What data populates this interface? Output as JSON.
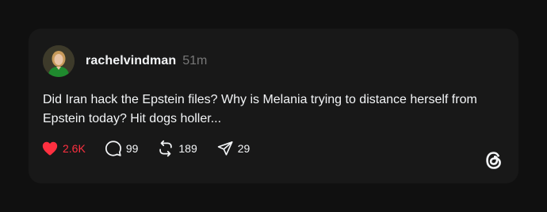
{
  "post": {
    "username": "rachelvindman",
    "timestamp": "51m",
    "text_line1": "Did Iran hack the Epstein files? Why is Melania trying to distance herself from",
    "text_line2": "Epstein today? Hit dogs holler..."
  },
  "actions": {
    "like_count": "2.6K",
    "comment_count": "99",
    "repost_count": "189",
    "share_count": "29"
  },
  "colors": {
    "background": "#101010",
    "card": "#181818",
    "text": "#f3f5f7",
    "muted": "#777777",
    "like": "#ff3040"
  },
  "icons": {
    "like": "heart-filled-icon",
    "comment": "comment-bubble-icon",
    "repost": "repost-arrows-icon",
    "share": "send-paper-plane-icon",
    "brand": "threads-logo-icon"
  }
}
